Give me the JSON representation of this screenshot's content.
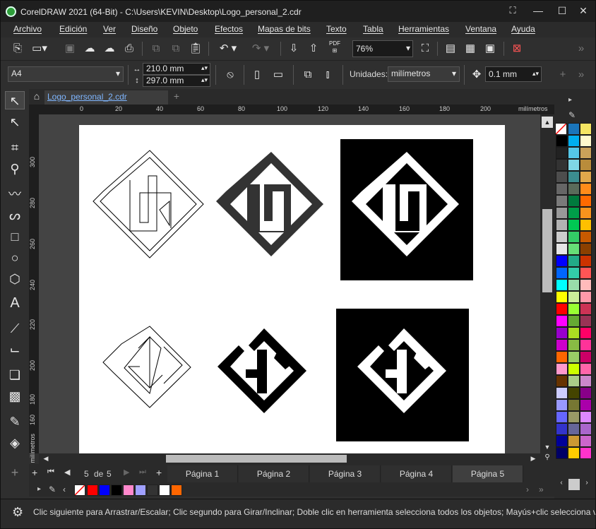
{
  "window": {
    "title": "CorelDRAW 2021 (64-Bit) - C:\\Users\\KEVIN\\Desktop\\Logo_personal_2.cdr",
    "minimize": "—",
    "maximize": "☐",
    "close": "✕"
  },
  "menu": [
    "Archivo",
    "Edición",
    "Ver",
    "Diseño",
    "Objeto",
    "Efectos",
    "Mapas de bits",
    "Texto",
    "Tabla",
    "Herramientas",
    "Ventana",
    "Ayuda"
  ],
  "standard_toolbar": {
    "zoom": "76%",
    "pdf_label": "PDF"
  },
  "property_bar": {
    "page_size": "A4",
    "width": "210.0 mm",
    "height": "297.0 mm",
    "units_label": "Unidades:",
    "units_value": "milímetros",
    "nudge": "0.1 mm"
  },
  "document_tab": "Logo_personal_2.cdr",
  "ruler": {
    "h_ticks": [
      "0",
      "20",
      "40",
      "60",
      "80",
      "100",
      "120",
      "140",
      "160",
      "180",
      "200"
    ],
    "h_unit": "milímetros",
    "v_ticks": [
      "300",
      "280",
      "260",
      "240",
      "220",
      "200",
      "180",
      "160"
    ],
    "v_unit": "milímetros"
  },
  "page_nav": {
    "current": "5",
    "of": "de",
    "total": "5",
    "pages": [
      "Página 1",
      "Página 2",
      "Página 3",
      "Página 4",
      "Página 5"
    ],
    "active_page": "Página 5"
  },
  "document_palette": [
    "#ff0000",
    "#0000ff",
    "#000000",
    "#ff88cc",
    "#a0a0ff",
    "#333333",
    "#ffffff",
    "#ff6600"
  ],
  "color_palette": [
    "#ffffff",
    "#1a75bb",
    "#f5e663",
    "#000000",
    "#00aeef",
    "#fffacd",
    "#222222",
    "#55c7e8",
    "#c9a25a",
    "#333333",
    "#7fd6e6",
    "#b98c3b",
    "#4d4d4d",
    "#3b8d8f",
    "#e0a84b",
    "#666666",
    "#5a6b5a",
    "#ff8c1a",
    "#7a7a7a",
    "#007a3d",
    "#ff6a00",
    "#999999",
    "#009e49",
    "#f7941d",
    "#b3b3b3",
    "#00c853",
    "#ffc000",
    "#cccccc",
    "#33cc66",
    "#c85a00",
    "#e6e6e6",
    "#66dd77",
    "#8b4000",
    "#0000ff",
    "#22aa88",
    "#cc3300",
    "#0066ff",
    "#33ccaa",
    "#ff5555",
    "#00ffff",
    "#99ddaa",
    "#ffbbbb",
    "#ffff00",
    "#ccee99",
    "#ff99aa",
    "#ff0000",
    "#99ff33",
    "#cc3355",
    "#ff00ff",
    "#66aa33",
    "#993355",
    "#9900cc",
    "#aadd22",
    "#ff0066",
    "#cc00cc",
    "#88bb44",
    "#ff3399",
    "#ff6600",
    "#99cc66",
    "#cc0066",
    "#ff99cc",
    "#ccff00",
    "#ff66aa",
    "#663300",
    "#aacc88",
    "#cc88cc",
    "#ccccff",
    "#444400",
    "#880088",
    "#9999ff",
    "#777733",
    "#aa00aa",
    "#6666ff",
    "#999966",
    "#dd88ff",
    "#3333cc",
    "#666699",
    "#aa66cc",
    "#000099",
    "#cc9933",
    "#cc66cc",
    "#000066",
    "#ffcc00",
    "#ff33cc"
  ],
  "status_text": "Clic siguiente para Arrastrar/Escalar; Clic segundo para Girar/Inclinar; Doble clic en herramienta selecciona todos los objetos; Mayús+clic selecciona va"
}
